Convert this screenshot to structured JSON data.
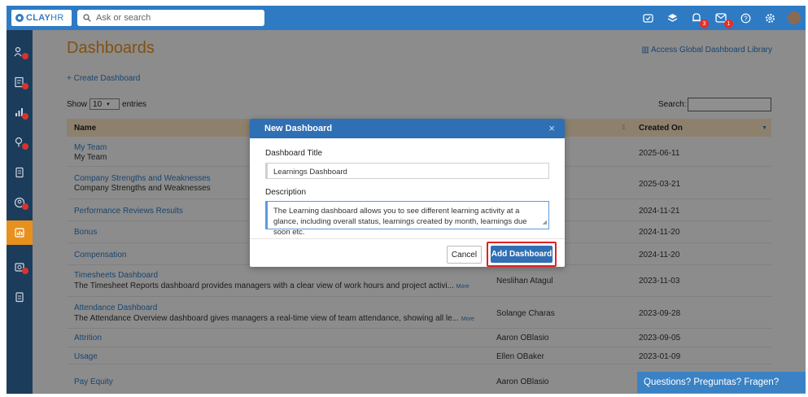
{
  "topbar": {
    "logo": {
      "main": "CLAY",
      "suffix": "HR"
    },
    "search_placeholder": "Ask or search",
    "notification_badge": "3",
    "inbox_badge": "1",
    "icons": [
      "checklist-icon",
      "layers-icon",
      "bell-icon",
      "mail-icon",
      "help-icon",
      "settings-icon",
      "avatar"
    ]
  },
  "sidebar": {
    "items": [
      "people-icon",
      "reports-icon",
      "analytics-icon",
      "goals-icon",
      "documents-icon",
      "settings-person-icon",
      "dashboard-icon",
      "time-icon",
      "clipboard-icon"
    ],
    "active_index": 6
  },
  "page": {
    "title": "Dashboards",
    "global_link": "Access Global Dashboard Library",
    "create_link": "Create Dashboard",
    "show_label": "Show",
    "entries_value": "10",
    "entries_label": "entries",
    "search_label": "Search:"
  },
  "table": {
    "columns": [
      "Name",
      "Created On"
    ],
    "rows": [
      {
        "name": "My Team",
        "description": "My Team",
        "owner": "",
        "created": "2025-06-11"
      },
      {
        "name": "Company Strengths and Weaknesses",
        "description": "Company Strengths and Weaknesses",
        "owner": "",
        "created": "2025-03-21"
      },
      {
        "name": "Performance Reviews Results",
        "description": "",
        "owner": "",
        "created": "2024-11-21"
      },
      {
        "name": "Bonus",
        "description": "",
        "owner": "",
        "created": "2024-11-20"
      },
      {
        "name": "Compensation",
        "description": "",
        "owner": "",
        "created": "2024-11-20"
      },
      {
        "name": "Timesheets Dashboard",
        "description": "The Timesheet Reports dashboard provides managers with a clear view of work hours and project activi...",
        "more": "More",
        "owner": "Neslihan Atagul",
        "created": "2023-11-03"
      },
      {
        "name": "Attendance Dashboard",
        "description": "The Attendance Overview dashboard gives managers a real-time view of team attendance, showing all le...",
        "more": "More",
        "owner": "Solange Charas",
        "created": "2023-09-28"
      },
      {
        "name": "Attrition",
        "description": "",
        "owner": "Aaron OBlasio",
        "created": "2023-09-05"
      },
      {
        "name": "Usage",
        "description": "",
        "owner": "Ellen OBaker",
        "created": "2023-01-09"
      },
      {
        "name": "Pay Equity",
        "description": "",
        "owner": "Aaron OBlasio",
        "created": ""
      }
    ]
  },
  "modal": {
    "title": "New Dashboard",
    "close": "×",
    "title_label": "Dashboard Title",
    "title_value": "Learnings Dashboard",
    "description_label": "Description",
    "description_value": "The Learning dashboard allows you to see different learning activity at a glance, including overall status, learnings created by month, learnings due soon etc.",
    "cancel_label": "Cancel",
    "add_label": "Add Dashboard"
  },
  "chat": {
    "label": "Questions? Preguntas? Fragen?"
  },
  "colors": {
    "brand": "#2e7bc4",
    "accent": "#e8901e",
    "sidebar": "#1c3c5c",
    "highlight": "#e41f25"
  }
}
